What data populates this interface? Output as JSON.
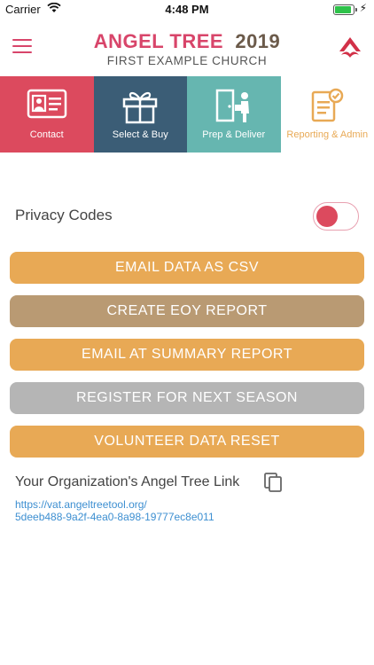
{
  "status_bar": {
    "carrier": "Carrier",
    "time": "4:48 PM"
  },
  "header": {
    "brand_name": "ANGEL TREE",
    "year": "2019",
    "church": "FIRST EXAMPLE CHURCH"
  },
  "tiles": [
    {
      "label": "Contact",
      "icon": "contact-card-icon"
    },
    {
      "label": "Select & Buy",
      "icon": "gift-icon"
    },
    {
      "label": "Prep & Deliver",
      "icon": "deliver-door-icon"
    },
    {
      "label": "Reporting & Admin",
      "icon": "report-check-icon"
    }
  ],
  "privacy": {
    "label": "Privacy Codes",
    "enabled": true
  },
  "actions": {
    "email_csv": "EMAIL DATA AS CSV",
    "eoy_report": "CREATE EOY REPORT",
    "summary_report": "EMAIL AT SUMMARY REPORT",
    "register": "REGISTER FOR NEXT SEASON",
    "volunteer_reset": "VOLUNTEER DATA RESET"
  },
  "org_link": {
    "title": "Your Organization's Angel Tree Link",
    "url_line1": "https://vat.angeltreetool.org/",
    "url_line2": "5deeb488-9a2f-4ea0-8a98-19777ec8e011"
  },
  "colors": {
    "brand_pink": "#dc4a5e",
    "navy": "#3b5d76",
    "teal": "#66b6b0",
    "orange": "#e8a955",
    "tan": "#b99a73",
    "gray": "#b5b5b5",
    "link_blue": "#3d8fd1"
  }
}
